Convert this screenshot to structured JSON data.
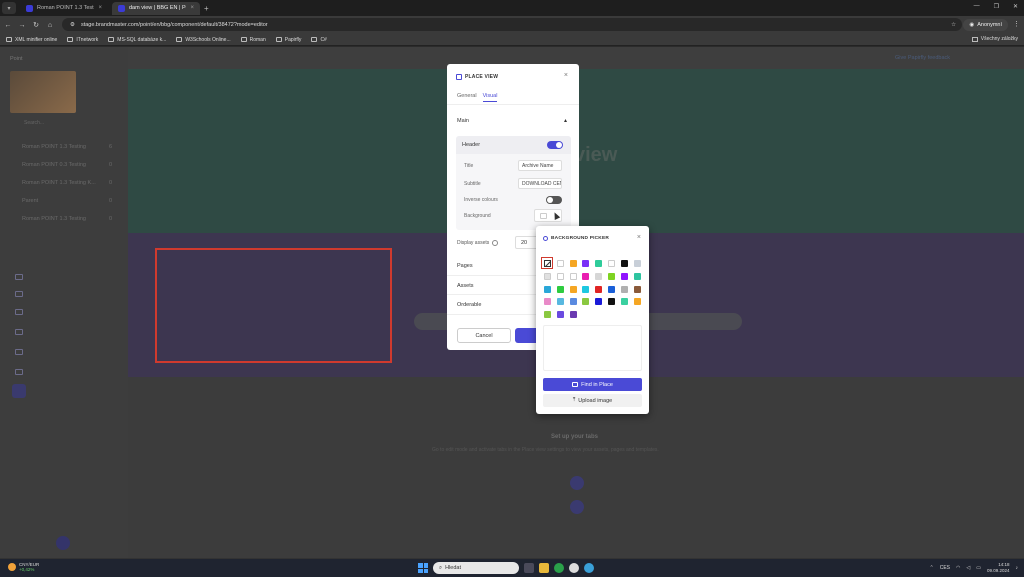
{
  "browser": {
    "tabs": [
      {
        "title": "Roman POINT 1.3 Testing EN | ..."
      },
      {
        "title": "dam view | BBG EN | Point"
      }
    ],
    "url": "stage.brandmaster.com/point/en/bbg/component/default/38472?mode=editor",
    "profile": "Anonymní",
    "bookmarks": [
      "XML minifier online",
      "ITnetwork",
      "MS-SQL databáze k...",
      "W3Schools Online...",
      "Roman",
      "Papirfly",
      "C#"
    ],
    "bookmarks_right": "Všechny záložky"
  },
  "app": {
    "name": "Point",
    "sidebar_search": "Search...",
    "sidebar_items": [
      {
        "label": "Roman POINT 1.3 Testing",
        "count": "6"
      },
      {
        "label": "Roman POINT 0.3 Testing",
        "count": "0"
      },
      {
        "label": "Roman POINT 1.3 Testing K...",
        "count": "0"
      },
      {
        "label": "Parent",
        "count": "0"
      },
      {
        "label": "Roman POINT 1.3 Testing",
        "count": "0"
      }
    ],
    "feedback": "Give Papirfly feedback",
    "hero_text": "view",
    "setup_title": "Set up your tabs",
    "setup_desc": "Go to edit mode and activate tabs in the Place view settings to view your assets, pages and templates."
  },
  "modal": {
    "title": "PLACE VIEW",
    "tabs": {
      "general": "General",
      "visual": "Visual"
    },
    "section_main": "Main",
    "header_label": "Header",
    "fields": {
      "title_label": "Title",
      "title_value": "Archive Name",
      "subtitle_label": "Subtitle",
      "subtitle_value": "DOWNLOAD CENTER",
      "inverse_label": "Inverse colours",
      "background_label": "Background"
    },
    "display_assets_label": "Display assets",
    "display_assets_value": "20",
    "sections": [
      "Pages",
      "Assets",
      "Orderable"
    ],
    "cancel": "Cancel"
  },
  "picker": {
    "title": "BACKGROUND PICKER",
    "find_label": "Find in Place",
    "upload_label": "Upload image",
    "swatch_rows": [
      [
        "#ffffff",
        "#f5a623",
        "#7b2ff7",
        "#2ecc9a",
        "#ffffff",
        "#111111",
        "#c8cfd8"
      ],
      [
        "#e0e0e0",
        "#ffffff",
        "#ffffff",
        "#e91eb0",
        "#d6d6d6",
        "#7ed321",
        "#9013fe",
        "#2ec4a0"
      ],
      [
        "#2aa7d8",
        "#2ecc40",
        "#f5a623",
        "#1ec8e0",
        "#e02424",
        "#1a5fd8",
        "#b0b0b0",
        "#8a5a3a"
      ],
      [
        "#e98ac8",
        "#58b8e0",
        "#5a8ae0",
        "#8ac840",
        "#1a1ad8",
        "#111111",
        "#3ad0a0",
        "#f5a623"
      ],
      [
        "#8ac840",
        "#6a4ae0",
        "#6a3ab0"
      ]
    ]
  },
  "taskbar": {
    "weather_title": "CNY/EUR",
    "weather_change": "+0,42%",
    "search_placeholder": "Hledat",
    "lang": "CES",
    "time": "14:18",
    "date": "09.09.2024"
  }
}
